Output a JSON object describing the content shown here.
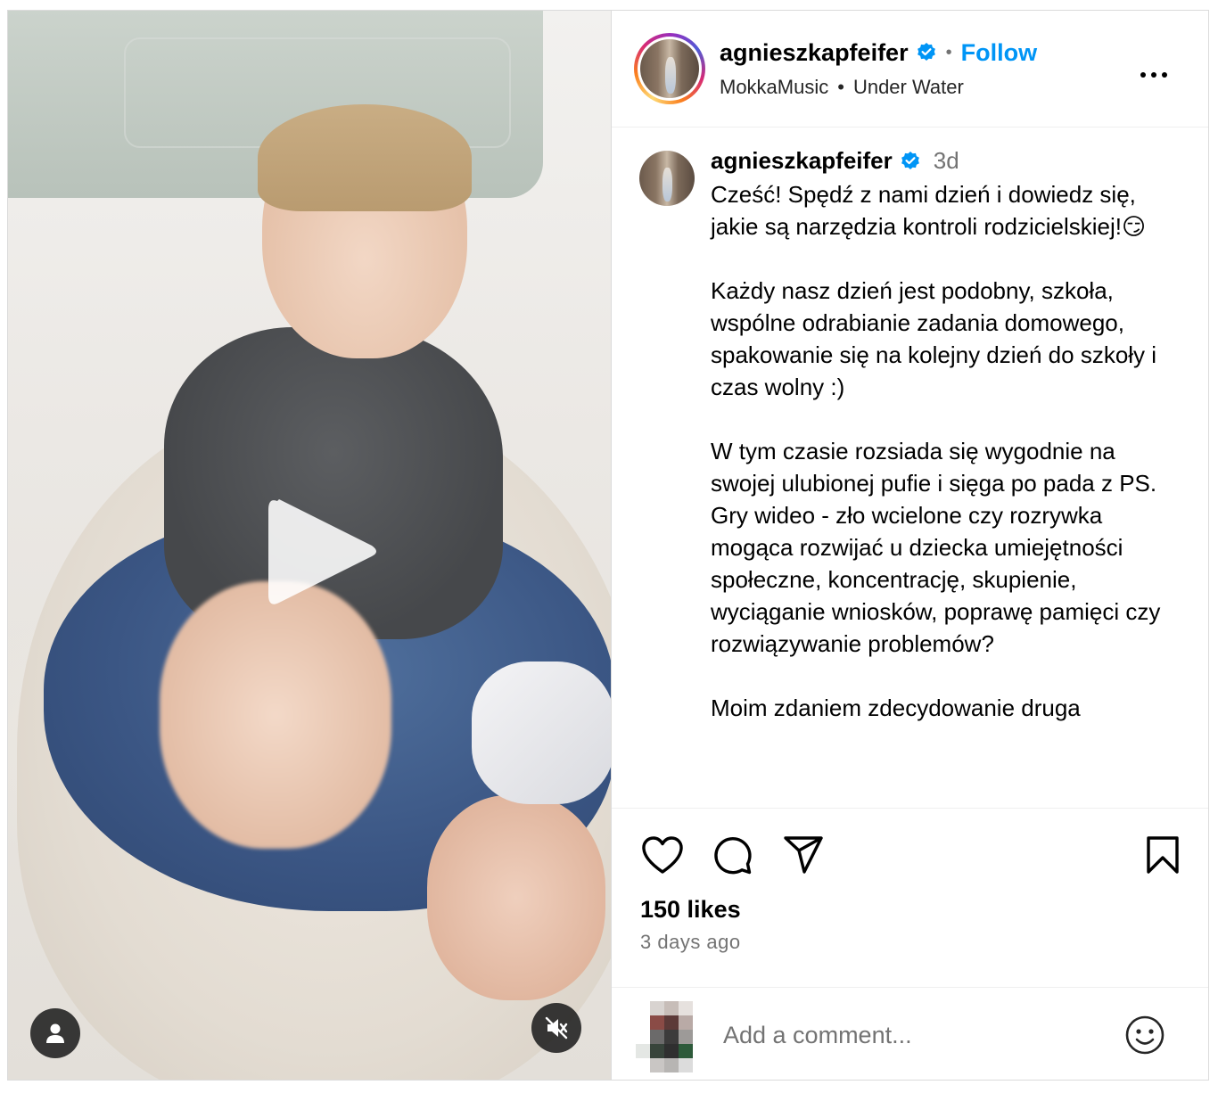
{
  "post": {
    "author": {
      "username": "agnieszkapfeifer",
      "verified": true
    },
    "follow_label": "Follow",
    "audio": {
      "artist": "MokkaMusic",
      "track": "Under Water",
      "separator": "•"
    },
    "header_dot": "•",
    "caption": {
      "username": "agnieszkapfeifer",
      "time": "3d",
      "text": "Cześć! Spędź z nami dzień i dowiedz się, jakie są narzędzia kontroli rodzicielskiej!😏\n\nKażdy nasz dzień jest podobny, szkoła, wspólne odrabianie zadania domowego, spakowanie się na kolejny dzień do szkoły i czas wolny :)\n\nW tym czasie rozsiada się wygodnie na swojej ulubionej pufie i sięga po pada z PS. Gry wideo - zło wcielone czy rozrywka mogąca rozwijać u dziecka umiejętności społeczne, koncentrację, skupienie, wyciąganie wniosków, poprawę pamięci czy rozwiązywanie problemów?\n\nMoim zdaniem zdecydowanie druga"
    },
    "likes": "150 likes",
    "posted_ago": "3 days ago",
    "comment": {
      "placeholder": "Add a comment..."
    }
  },
  "icons": {
    "verified": "verified-badge-icon",
    "more": "more-options-icon",
    "play": "play-icon",
    "user_tag": "person-icon",
    "mute": "speaker-muted-icon",
    "like": "heart-icon",
    "comment": "comment-bubble-icon",
    "share": "paper-plane-icon",
    "save": "bookmark-icon",
    "emoji": "smiley-icon"
  },
  "colors": {
    "accent": "#0095f6",
    "secondary_text": "#737373",
    "border": "#dbdbdb"
  }
}
